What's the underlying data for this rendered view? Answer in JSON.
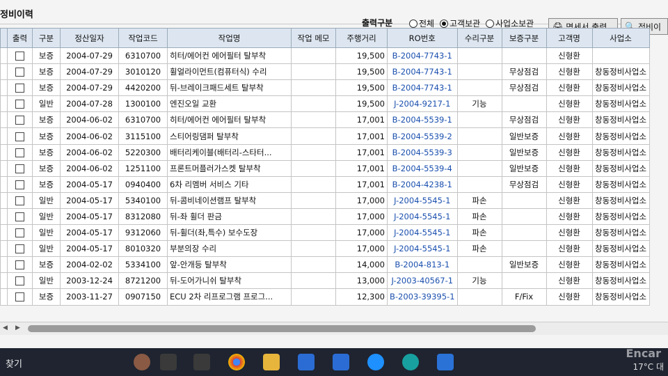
{
  "app": {
    "title": "정비이력"
  },
  "toolbar": {
    "print_type_label": "출력구분",
    "radios": [
      {
        "label": "전체",
        "selected": false
      },
      {
        "label": "고객보관",
        "selected": true
      },
      {
        "label": "사업소보관",
        "selected": false
      }
    ],
    "print_button_label": "명세서 출력",
    "search_button_label": "정비이"
  },
  "table": {
    "columns": [
      "출력",
      "구분",
      "정산일자",
      "작업코드",
      "작업명",
      "작업 메모",
      "주행거리",
      "RO번호",
      "수리구분",
      "보증구분",
      "고객명",
      "사업소"
    ],
    "rows": [
      {
        "type": "보증",
        "date": "2004-07-29",
        "code": "6310700",
        "name": "히터/에어컨 에어필터 탈부착",
        "memo": "",
        "km": "19,500",
        "ro": "B-2004-7743-1",
        "repair": "",
        "warranty": "",
        "customer": "신형환",
        "office": ""
      },
      {
        "type": "보증",
        "date": "2004-07-29",
        "code": "3010120",
        "name": "휠얼라이먼트(컴퓨터식) 수리",
        "memo": "",
        "km": "19,500",
        "ro": "B-2004-7743-1",
        "repair": "",
        "warranty": "무상점검",
        "customer": "신형환",
        "office": "창동정비사업소"
      },
      {
        "type": "보증",
        "date": "2004-07-29",
        "code": "4420200",
        "name": "뒤-브레이크패드세트 탈부착",
        "memo": "",
        "km": "19,500",
        "ro": "B-2004-7743-1",
        "repair": "",
        "warranty": "무상점검",
        "customer": "신형환",
        "office": "창동정비사업소"
      },
      {
        "type": "일반",
        "date": "2004-07-28",
        "code": "1300100",
        "name": "엔진오일 교환",
        "memo": "",
        "km": "19,500",
        "ro": "J-2004-9217-1",
        "repair": "기능",
        "warranty": "",
        "customer": "신형환",
        "office": "창동정비사업소"
      },
      {
        "type": "보증",
        "date": "2004-06-02",
        "code": "6310700",
        "name": "히터/에어컨 에어필터 탈부착",
        "memo": "",
        "km": "17,001",
        "ro": "B-2004-5539-1",
        "repair": "",
        "warranty": "무상점검",
        "customer": "신형환",
        "office": "창동정비사업소"
      },
      {
        "type": "보증",
        "date": "2004-06-02",
        "code": "3115100",
        "name": "스티어링댐퍼 탈부착",
        "memo": "",
        "km": "17,001",
        "ro": "B-2004-5539-2",
        "repair": "",
        "warranty": "일반보증",
        "customer": "신형환",
        "office": "창동정비사업소"
      },
      {
        "type": "보증",
        "date": "2004-06-02",
        "code": "5220300",
        "name": "배터리케이블(배터리-스타터...",
        "memo": "",
        "km": "17,001",
        "ro": "B-2004-5539-3",
        "repair": "",
        "warranty": "일반보증",
        "customer": "신형환",
        "office": "창동정비사업소"
      },
      {
        "type": "보증",
        "date": "2004-06-02",
        "code": "1251100",
        "name": "프론트머플러가스켓 탈부착",
        "memo": "",
        "km": "17,001",
        "ro": "B-2004-5539-4",
        "repair": "",
        "warranty": "일반보증",
        "customer": "신형환",
        "office": "창동정비사업소"
      },
      {
        "type": "보증",
        "date": "2004-05-17",
        "code": "0940400",
        "name": "6차 리멤버 서비스 기타",
        "memo": "",
        "km": "17,001",
        "ro": "B-2004-4238-1",
        "repair": "",
        "warranty": "무상점검",
        "customer": "신형환",
        "office": "창동정비사업소"
      },
      {
        "type": "일반",
        "date": "2004-05-17",
        "code": "5340100",
        "name": "뒤-콤비네이션램프 탈부착",
        "memo": "",
        "km": "17,000",
        "ro": "J-2004-5545-1",
        "repair": "파손",
        "warranty": "",
        "customer": "신형환",
        "office": "창동정비사업소"
      },
      {
        "type": "일반",
        "date": "2004-05-17",
        "code": "8312080",
        "name": "뒤-좌 휠더 판금",
        "memo": "",
        "km": "17,000",
        "ro": "J-2004-5545-1",
        "repair": "파손",
        "warranty": "",
        "customer": "신형환",
        "office": "창동정비사업소"
      },
      {
        "type": "일반",
        "date": "2004-05-17",
        "code": "9312060",
        "name": "뒤-휠더(좌,특수) 보수도장",
        "memo": "",
        "km": "17,000",
        "ro": "J-2004-5545-1",
        "repair": "파손",
        "warranty": "",
        "customer": "신형환",
        "office": "창동정비사업소"
      },
      {
        "type": "일반",
        "date": "2004-05-17",
        "code": "8010320",
        "name": "부분의장 수리",
        "memo": "",
        "km": "17,000",
        "ro": "J-2004-5545-1",
        "repair": "파손",
        "warranty": "",
        "customer": "신형환",
        "office": "창동정비사업소"
      },
      {
        "type": "보증",
        "date": "2004-02-02",
        "code": "5334100",
        "name": "앞-안개등 탈부착",
        "memo": "",
        "km": "14,000",
        "ro": "B-2004-813-1",
        "repair": "",
        "warranty": "일반보증",
        "customer": "신형환",
        "office": "창동정비사업소"
      },
      {
        "type": "일반",
        "date": "2003-12-24",
        "code": "8721200",
        "name": "뒤-도어가니쉬 탈부착",
        "memo": "",
        "km": "13,000",
        "ro": "J-2003-40567-1",
        "repair": "기능",
        "warranty": "",
        "customer": "신형환",
        "office": "창동정비사업소"
      },
      {
        "type": "보증",
        "date": "2003-11-27",
        "code": "0907150",
        "name": "ECU 2차 리프로그램 프로그...",
        "memo": "",
        "km": "12,300",
        "ro": "B-2003-39395-1",
        "repair": "",
        "warranty": "F/Fix",
        "customer": "신형환",
        "office": "창동정비사업소"
      }
    ]
  },
  "taskbar": {
    "search_text": "찾기",
    "temperature": "17°C",
    "weather_text": "대"
  },
  "watermark": "Encar"
}
